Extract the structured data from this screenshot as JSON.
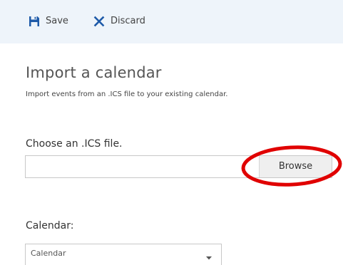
{
  "toolbar": {
    "save_label": "Save",
    "discard_label": "Discard",
    "save_icon": "floppy-disk-icon",
    "discard_icon": "x-close-icon",
    "background": "#eef4fa",
    "icon_color": "#1e5aa8"
  },
  "heading": {
    "title": "Import a calendar",
    "subtitle": "Import events from an .ICS file to your existing calendar."
  },
  "file_picker": {
    "label": "Choose an .ICS file.",
    "value": "",
    "browse_label": "Browse",
    "highlight_color": "#e00000"
  },
  "calendar_select": {
    "label": "Calendar:",
    "selected": "Calendar",
    "caret_icon": "caret-down-icon"
  }
}
